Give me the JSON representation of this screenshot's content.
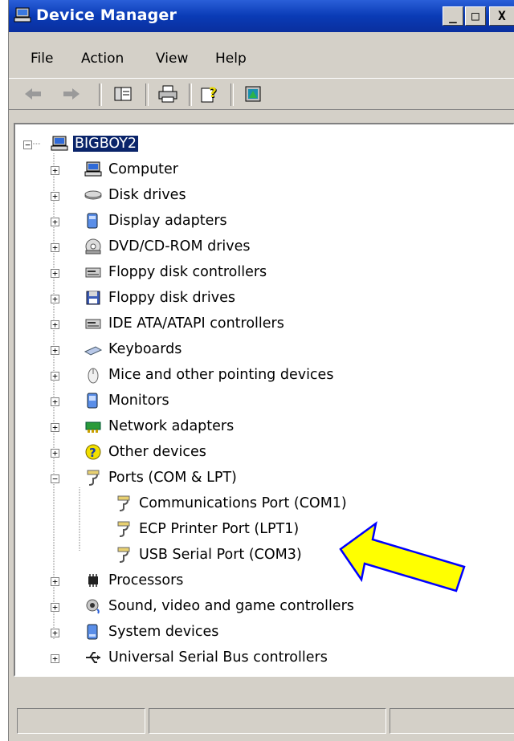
{
  "window": {
    "title": "Device Manager",
    "controls": {
      "minimize": "_",
      "maximize": "□",
      "close": "X"
    }
  },
  "menu": {
    "items": [
      {
        "label": "File"
      },
      {
        "label": "Action"
      },
      {
        "label": "View"
      },
      {
        "label": "Help"
      }
    ]
  },
  "toolbar": {
    "buttons": [
      {
        "icon": "back-arrow-icon"
      },
      {
        "icon": "forward-arrow-icon"
      },
      {
        "icon": "show-hide-tree-icon"
      },
      {
        "icon": "print-icon"
      },
      {
        "icon": "help-icon"
      },
      {
        "icon": "properties-icon"
      }
    ]
  },
  "tree": {
    "root": {
      "label": "BIGBOY2",
      "expanded": true,
      "selected": true,
      "icon": "computer-icon"
    },
    "categories": [
      {
        "label": "Computer",
        "icon": "computer-icon",
        "expanded": false
      },
      {
        "label": "Disk drives",
        "icon": "disk-drive-icon",
        "expanded": false
      },
      {
        "label": "Display adapters",
        "icon": "display-adapter-icon",
        "expanded": false
      },
      {
        "label": "DVD/CD-ROM drives",
        "icon": "cd-rom-icon",
        "expanded": false
      },
      {
        "label": "Floppy disk controllers",
        "icon": "controller-icon",
        "expanded": false
      },
      {
        "label": "Floppy disk drives",
        "icon": "floppy-icon",
        "expanded": false
      },
      {
        "label": "IDE ATA/ATAPI controllers",
        "icon": "controller-icon",
        "expanded": false
      },
      {
        "label": "Keyboards",
        "icon": "keyboard-icon",
        "expanded": false
      },
      {
        "label": "Mice and other pointing devices",
        "icon": "mouse-icon",
        "expanded": false
      },
      {
        "label": "Monitors",
        "icon": "monitor-icon",
        "expanded": false
      },
      {
        "label": "Network adapters",
        "icon": "network-adapter-icon",
        "expanded": false
      },
      {
        "label": "Other devices",
        "icon": "unknown-device-icon",
        "expanded": false
      },
      {
        "label": "Ports (COM & LPT)",
        "icon": "port-icon",
        "expanded": true,
        "children": [
          {
            "label": "Communications Port (COM1)",
            "icon": "port-icon"
          },
          {
            "label": "ECP Printer Port (LPT1)",
            "icon": "port-icon"
          },
          {
            "label": "USB Serial Port (COM3)",
            "icon": "port-icon"
          }
        ]
      },
      {
        "label": "Processors",
        "icon": "processor-icon",
        "expanded": false
      },
      {
        "label": "Sound, video and game controllers",
        "icon": "sound-icon",
        "expanded": false
      },
      {
        "label": "System devices",
        "icon": "system-device-icon",
        "expanded": false
      },
      {
        "label": "Universal Serial Bus controllers",
        "icon": "usb-icon",
        "expanded": false
      }
    ]
  },
  "annotation": {
    "color": "#ffff00",
    "outline": "#0000ff",
    "target": "USB Serial Port (COM3)"
  },
  "colors": {
    "title_bar": "#0a3bb6",
    "selection": "#0a246a",
    "chrome": "#d4d0c8"
  }
}
